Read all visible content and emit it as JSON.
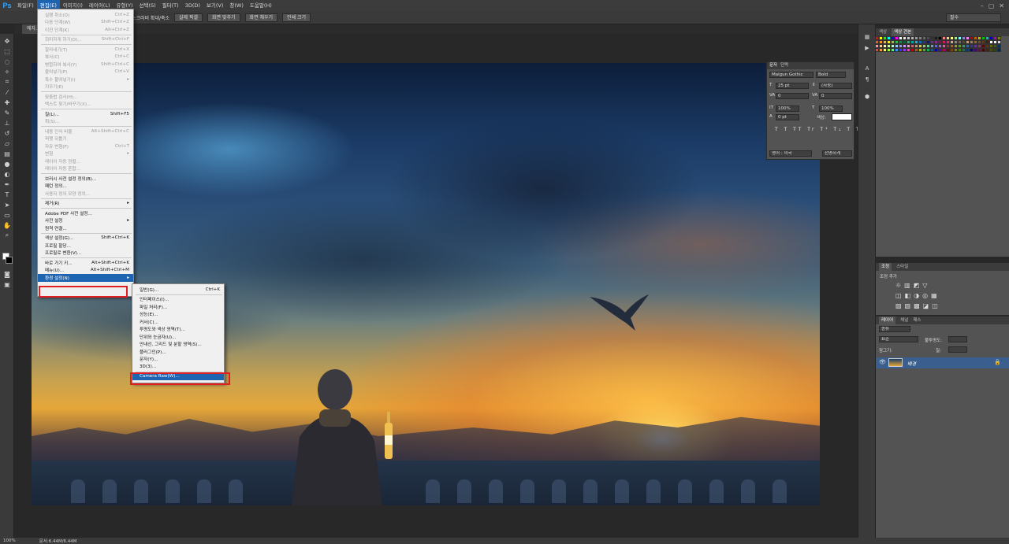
{
  "menubar": {
    "logo": "Ps",
    "items": [
      {
        "label": "파일(F)"
      },
      {
        "label": "편집(E)"
      },
      {
        "label": "이미지(I)"
      },
      {
        "label": "레이어(L)"
      },
      {
        "label": "유형(Y)"
      },
      {
        "label": "선택(S)"
      },
      {
        "label": "필터(T)"
      },
      {
        "label": "3D(D)"
      },
      {
        "label": "보기(V)"
      },
      {
        "label": "창(W)"
      },
      {
        "label": "도움말(H)"
      }
    ],
    "window_controls": [
      "–",
      "▢",
      "✕"
    ]
  },
  "options": {
    "scrubby_zoom": "✓ 스크러비 확대/축소",
    "buttons": [
      "실제 픽셀",
      "화면 맞추기",
      "화면 채우기",
      "인쇄 크기"
    ],
    "workspace": "필수"
  },
  "document": {
    "tab_label": "에자.jpg @"
  },
  "edit_menu": {
    "items": [
      {
        "label": "실행 취소(O)",
        "shortcut": "Ctrl+Z",
        "disabled": true
      },
      {
        "label": "다음 단계(W)",
        "shortcut": "Shift+Ctrl+Z",
        "disabled": true
      },
      {
        "label": "이전 단계(K)",
        "shortcut": "Alt+Ctrl+Z",
        "disabled": true
      },
      {
        "sep": true
      },
      {
        "label": "희미하게 하기(D)...",
        "shortcut": "Shift+Ctrl+F",
        "disabled": true
      },
      {
        "sep": true
      },
      {
        "label": "잘라내기(T)",
        "shortcut": "Ctrl+X",
        "disabled": true
      },
      {
        "label": "복사(C)",
        "shortcut": "Ctrl+C",
        "disabled": true
      },
      {
        "label": "병합하여 복사(Y)",
        "shortcut": "Shift+Ctrl+C",
        "disabled": true
      },
      {
        "label": "붙여넣기(P)",
        "shortcut": "Ctrl+V",
        "disabled": true
      },
      {
        "label": "특수 붙여넣기(I)",
        "shortcut": "▸",
        "disabled": true
      },
      {
        "label": "지우기(E)",
        "shortcut": "",
        "disabled": true
      },
      {
        "sep": true
      },
      {
        "label": "맞춤법 검사(H)...",
        "shortcut": "",
        "disabled": true
      },
      {
        "label": "텍스트 찾기/바꾸기(X)...",
        "shortcut": "",
        "disabled": true
      },
      {
        "sep": true
      },
      {
        "label": "칠(L)...",
        "shortcut": "Shift+F5",
        "disabled": false
      },
      {
        "label": "획(S)...",
        "shortcut": "",
        "disabled": true
      },
      {
        "sep": true
      },
      {
        "label": "내용 인식 비율",
        "shortcut": "Alt+Shift+Ctrl+C",
        "disabled": true
      },
      {
        "label": "퍼펫 뒤틀기",
        "shortcut": "",
        "disabled": true
      },
      {
        "label": "자유 변형(F)",
        "shortcut": "Ctrl+T",
        "disabled": true
      },
      {
        "label": "변형",
        "shortcut": "▸",
        "disabled": true
      },
      {
        "label": "레이어 자동 정렬...",
        "shortcut": "",
        "disabled": true
      },
      {
        "label": "레이어 자동 혼합...",
        "shortcut": "",
        "disabled": true
      },
      {
        "sep": true
      },
      {
        "label": "브러시 사전 설정 정의(B)...",
        "shortcut": "",
        "disabled": false
      },
      {
        "label": "패턴 정의...",
        "shortcut": "",
        "disabled": false
      },
      {
        "label": "사용자 정의 모양 정의...",
        "shortcut": "",
        "disabled": true
      },
      {
        "sep": true
      },
      {
        "label": "제거(R)",
        "shortcut": "▸",
        "disabled": false
      },
      {
        "sep": true
      },
      {
        "label": "Adobe PDF 사전 설정...",
        "shortcut": "",
        "disabled": false
      },
      {
        "label": "사전 설정",
        "shortcut": "▸",
        "disabled": false
      },
      {
        "label": "원격 연결...",
        "shortcut": "",
        "disabled": false
      },
      {
        "sep": true
      },
      {
        "label": "색상 설정(G)...",
        "shortcut": "Shift+Ctrl+K",
        "disabled": false
      },
      {
        "label": "프로필 할당...",
        "shortcut": "",
        "disabled": false
      },
      {
        "label": "프로필로 변환(V)...",
        "shortcut": "",
        "disabled": false
      },
      {
        "sep": true
      },
      {
        "label": "바로 가기 키...",
        "shortcut": "Alt+Shift+Ctrl+K",
        "disabled": false
      },
      {
        "label": "메뉴(U)...",
        "shortcut": "Alt+Shift+Ctrl+M",
        "disabled": false
      },
      {
        "label": "환경 설정(N)",
        "shortcut": "▸",
        "disabled": false,
        "highlight": true
      }
    ]
  },
  "prefs_submenu": {
    "items": [
      {
        "label": "일반(G)...",
        "shortcut": "Ctrl+K"
      },
      {
        "sep": true
      },
      {
        "label": "인터페이스(I)...",
        "shortcut": ""
      },
      {
        "label": "파일 처리(F)...",
        "shortcut": ""
      },
      {
        "label": "성능(E)...",
        "shortcut": ""
      },
      {
        "label": "커서(C)...",
        "shortcut": ""
      },
      {
        "label": "투명도와 색상 영역(T)...",
        "shortcut": ""
      },
      {
        "label": "단위와 눈금자(U)...",
        "shortcut": ""
      },
      {
        "label": "안내선, 그리드 및 분할 영역(S)...",
        "shortcut": ""
      },
      {
        "label": "플러그인(P)...",
        "shortcut": ""
      },
      {
        "label": "문자(Y)...",
        "shortcut": ""
      },
      {
        "label": "3D(3)...",
        "shortcut": ""
      },
      {
        "sep": true
      },
      {
        "label": "Camera Raw(W)...",
        "shortcut": "",
        "highlight": true
      }
    ]
  },
  "char_panel": {
    "tabs": [
      "문자",
      "단락"
    ],
    "font_family": "Malgun Gothic",
    "font_style": "Bold",
    "size": "25 pt",
    "leading": "(자동)",
    "kerning": "0",
    "tracking": "0",
    "vscale": "100%",
    "hscale": "100%",
    "baseline": "0 pt",
    "color_label": "색상:",
    "style_buttons": "T T TT Tr T¹ T₁ T T",
    "language": "영어 : 미국",
    "antialias": "선명하게"
  },
  "swatches_panel": {
    "tabs": [
      "색상",
      "색상 견본"
    ]
  },
  "adjust_panel": {
    "tabs": [
      "조정",
      "스타일"
    ],
    "title": "조정 추가"
  },
  "layers_panel": {
    "tabs": [
      "레이어",
      "채널",
      "패스"
    ],
    "filter": "종류",
    "blend_mode": "표준",
    "opacity_label": "불투명도:",
    "lock_label": "잠그기:",
    "fill_label": "칠:",
    "layer_name": "배경"
  },
  "statusbar": {
    "zoom": "100%",
    "doc_info": "문서:6.44M/6.44M"
  },
  "colors": {
    "accent": "#1f64b0",
    "highlight_box": "#e02020"
  }
}
